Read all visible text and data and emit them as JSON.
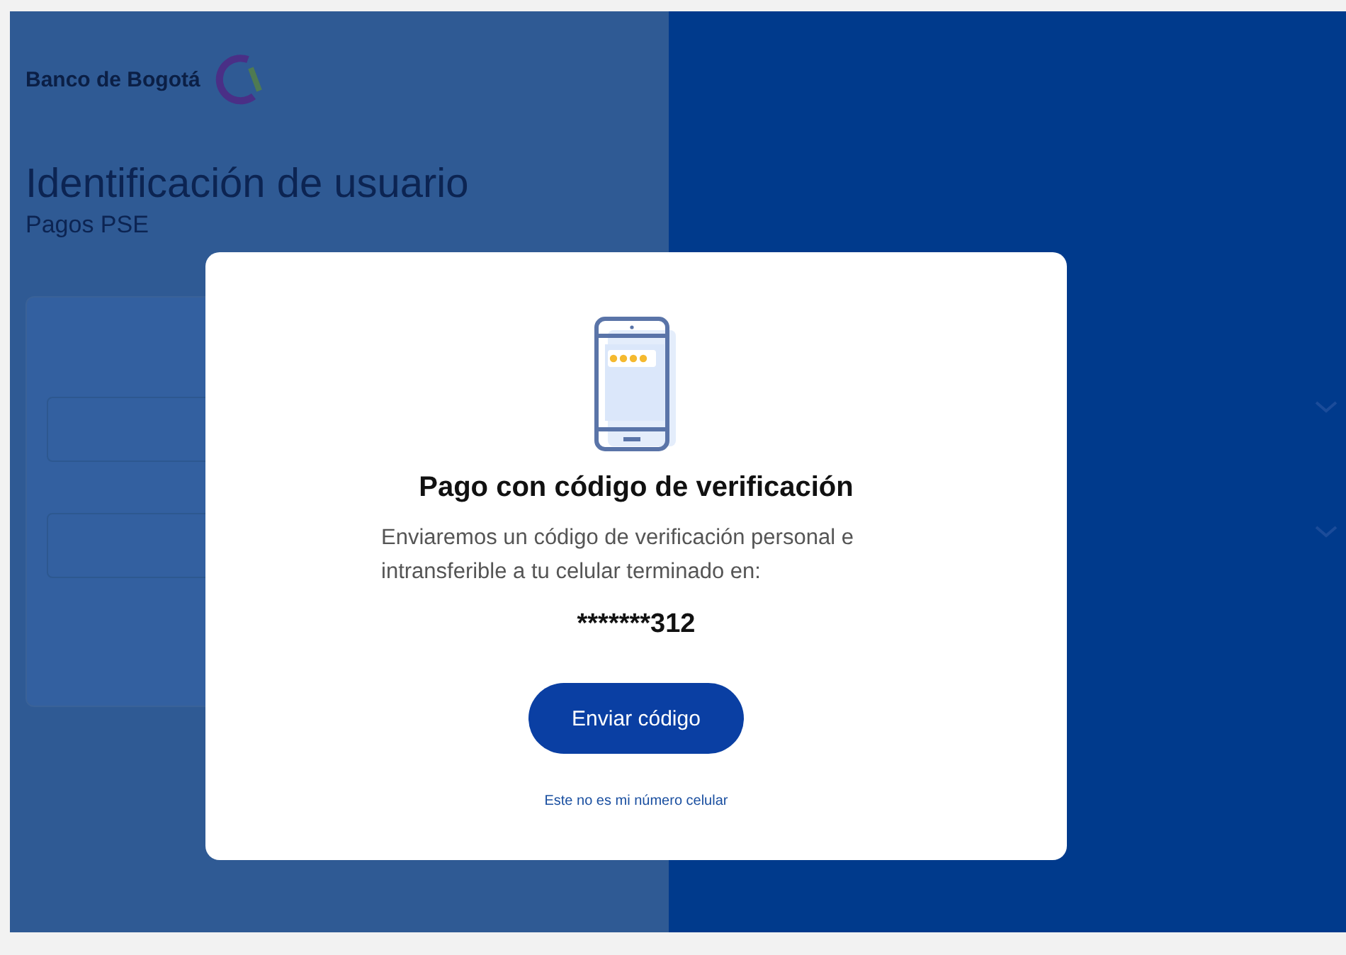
{
  "background": {
    "logo_text": "Banco de Bogotá",
    "title": "Identificación de usuario",
    "subtitle": "Pagos PSE"
  },
  "modal": {
    "title": "Pago con código de verificación",
    "message": "Enviaremos un código de verificación personal e intransferible a tu celular terminado en:",
    "masked_number": "*******312",
    "primary_button": "Enviar código",
    "link": "Este no es mi número celular"
  }
}
